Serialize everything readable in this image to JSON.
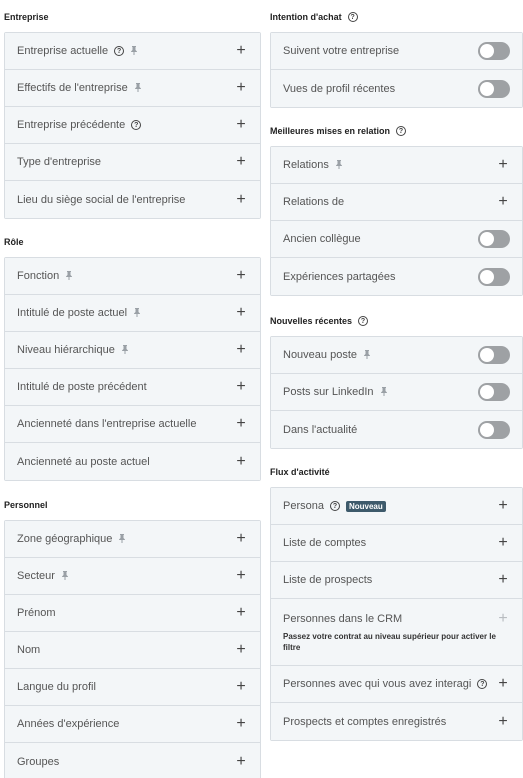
{
  "left": [
    {
      "title": "Entreprise",
      "help": false,
      "rows": [
        {
          "label": "Entreprise actuelle",
          "help": true,
          "pin": true
        },
        {
          "label": "Effectifs de l'entreprise",
          "help": false,
          "pin": true
        },
        {
          "label": "Entreprise précédente",
          "help": true,
          "pin": false
        },
        {
          "label": "Type d'entreprise",
          "help": false,
          "pin": false
        },
        {
          "label": "Lieu du siège social de l'entreprise",
          "help": false,
          "pin": false
        }
      ]
    },
    {
      "title": "Rôle",
      "help": false,
      "rows": [
        {
          "label": "Fonction",
          "help": false,
          "pin": true
        },
        {
          "label": "Intitulé de poste actuel",
          "help": false,
          "pin": true
        },
        {
          "label": "Niveau hiérarchique",
          "help": false,
          "pin": true
        },
        {
          "label": "Intitulé de poste précédent",
          "help": false,
          "pin": false
        },
        {
          "label": "Ancienneté dans l'entreprise actuelle",
          "help": false,
          "pin": false
        },
        {
          "label": "Ancienneté au poste actuel",
          "help": false,
          "pin": false
        }
      ]
    },
    {
      "title": "Personnel",
      "help": false,
      "rows": [
        {
          "label": "Zone géographique",
          "help": false,
          "pin": true
        },
        {
          "label": "Secteur",
          "help": false,
          "pin": true
        },
        {
          "label": "Prénom",
          "help": false,
          "pin": false
        },
        {
          "label": "Nom",
          "help": false,
          "pin": false
        },
        {
          "label": "Langue du profil",
          "help": false,
          "pin": false
        },
        {
          "label": "Années d'expérience",
          "help": false,
          "pin": false
        },
        {
          "label": "Groupes",
          "help": false,
          "pin": false
        }
      ]
    }
  ],
  "right": [
    {
      "title": "Intention d'achat",
      "help": true,
      "rows": [
        {
          "label": "Suivent votre entreprise",
          "control": "toggle",
          "toggle_on": false
        },
        {
          "label": "Vues de profil récentes",
          "control": "toggle",
          "toggle_on": false
        }
      ]
    },
    {
      "title": "Meilleures mises en relation",
      "help": true,
      "rows": [
        {
          "label": "Relations",
          "pin": true,
          "control": "plus"
        },
        {
          "label": "Relations de",
          "control": "plus"
        },
        {
          "label": "Ancien collègue",
          "control": "toggle",
          "toggle_on": false
        },
        {
          "label": "Expériences partagées",
          "control": "toggle",
          "toggle_on": false
        }
      ]
    },
    {
      "title": "Nouvelles récentes",
      "help": true,
      "rows": [
        {
          "label": "Nouveau poste",
          "pin": true,
          "control": "toggle",
          "toggle_on": false
        },
        {
          "label": "Posts sur LinkedIn",
          "pin": true,
          "control": "toggle",
          "toggle_on": false
        },
        {
          "label": "Dans l'actualité",
          "control": "toggle",
          "toggle_on": false
        }
      ]
    },
    {
      "title": "Flux d'activité",
      "help": false,
      "rows": [
        {
          "label": "Persona",
          "help": true,
          "badge": "Nouveau",
          "control": "plus"
        },
        {
          "label": "Liste de comptes",
          "control": "plus"
        },
        {
          "label": "Liste de prospects",
          "control": "plus"
        },
        {
          "label": "Personnes dans le CRM",
          "control": "plus",
          "disabled": true,
          "note": "Passez votre contrat au niveau supérieur pour activer le filtre"
        },
        {
          "label": "Personnes avec qui vous avez interagi",
          "help": true,
          "control": "plus"
        },
        {
          "label": "Prospects et comptes enregistrés",
          "control": "plus"
        }
      ]
    }
  ],
  "icons": {
    "pin": "pin-icon",
    "help": "help-icon",
    "plus": "plus-icon",
    "toggle": "toggle-switch"
  },
  "colors": {
    "panel_bg": "#f3f6f8",
    "border": "#d8dde2",
    "toggle_off": "#9ea1a4",
    "badge_bg": "#3d5a6b"
  }
}
